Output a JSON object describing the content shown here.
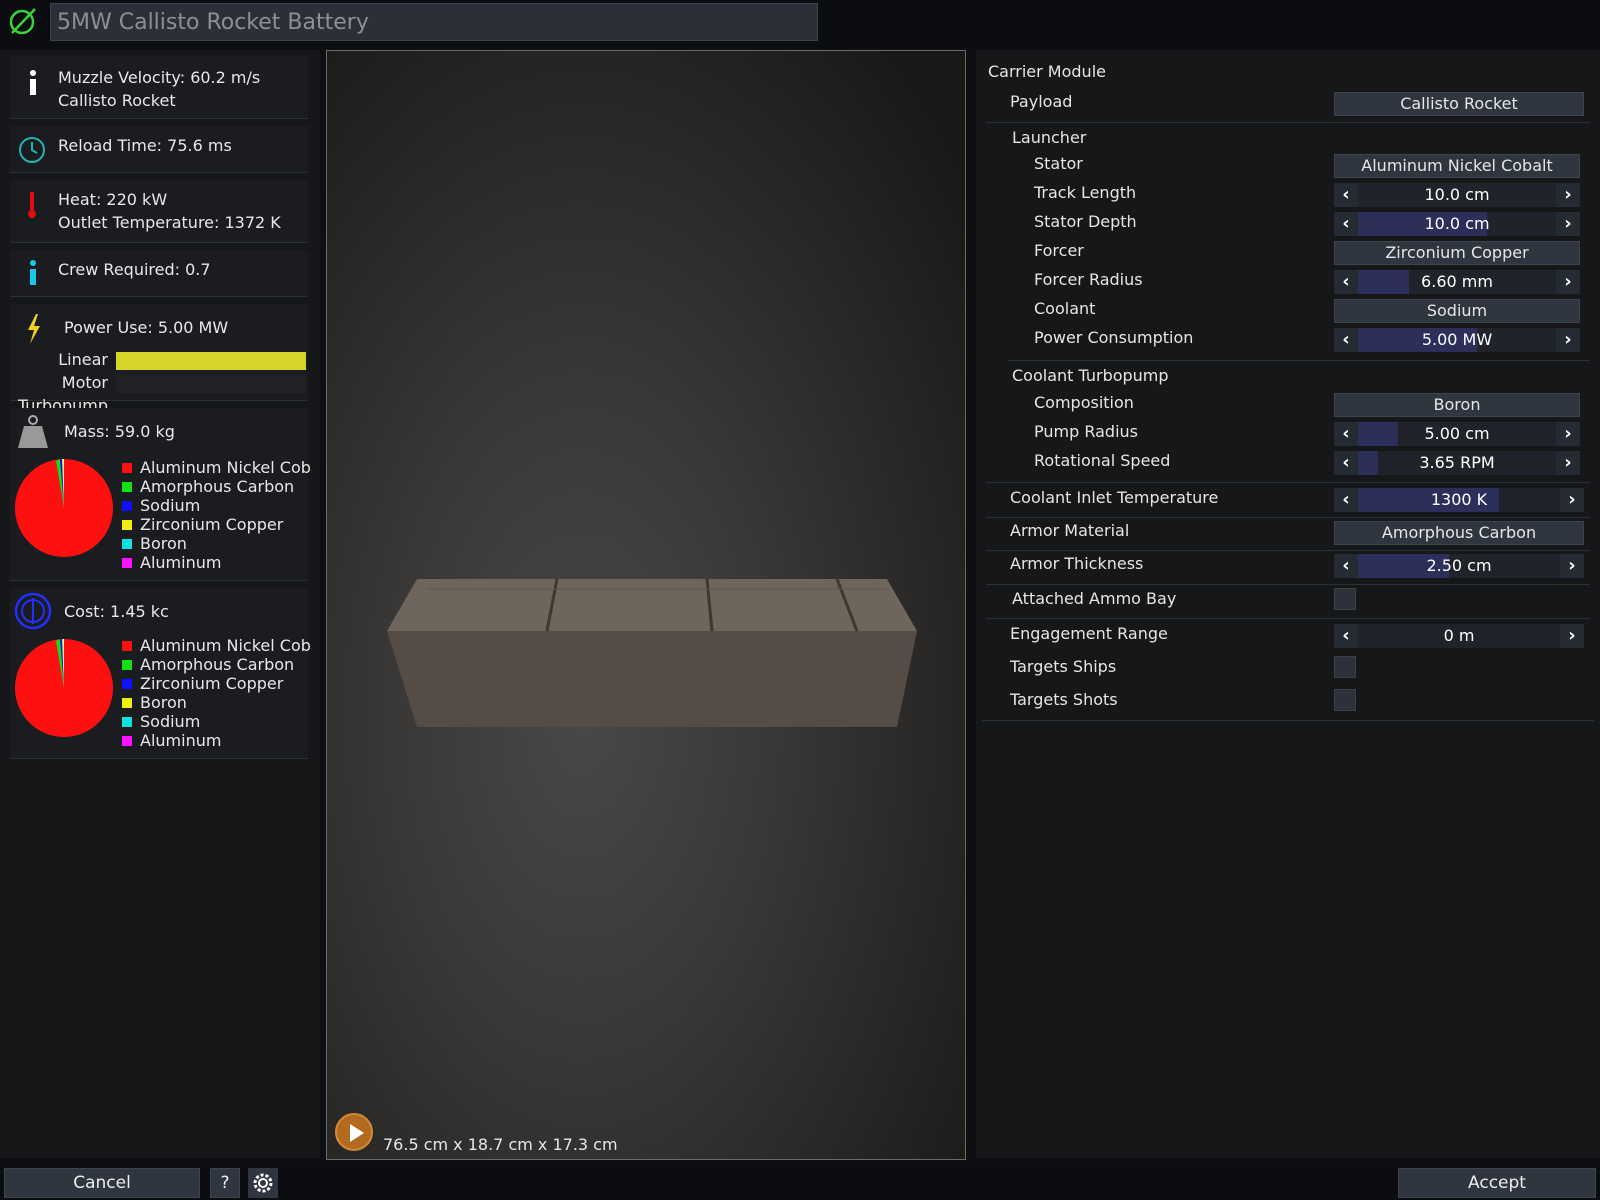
{
  "window": {
    "title": "5MW Callisto Rocket Battery"
  },
  "stats": {
    "muzzle_velocity": "Muzzle Velocity: 60.2 m/s",
    "payload_name": "Callisto Rocket",
    "reload_time": "Reload Time: 75.6 ms",
    "heat": "Heat: 220 kW",
    "outlet_temperature": "Outlet Temperature: 1372 K",
    "crew": "Crew Required: 0.7",
    "power_use": "Power Use: 5.00 MW",
    "power_bars": [
      {
        "label": "Linear Motor",
        "fraction": 1.0,
        "color": "#d6d62a"
      },
      {
        "label": "Turbopump",
        "fraction": 0.0,
        "color": "#d6d62a"
      }
    ],
    "mass": "Mass: 59.0 kg",
    "mass_legend": [
      {
        "label": "Aluminum Nickel Cobalt",
        "color": "#ff1010"
      },
      {
        "label": "Amorphous Carbon",
        "color": "#10e010"
      },
      {
        "label": "Sodium",
        "color": "#1010ff"
      },
      {
        "label": "Zirconium Copper",
        "color": "#f0f010"
      },
      {
        "label": "Boron",
        "color": "#10e0e0"
      },
      {
        "label": "Aluminum",
        "color": "#ff10ff"
      }
    ],
    "cost": "Cost: 1.45 kc",
    "cost_legend": [
      {
        "label": "Aluminum Nickel Cobalt",
        "color": "#ff1010"
      },
      {
        "label": "Amorphous Carbon",
        "color": "#10e010"
      },
      {
        "label": "Zirconium Copper",
        "color": "#1010ff"
      },
      {
        "label": "Boron",
        "color": "#f0f010"
      },
      {
        "label": "Sodium",
        "color": "#10e0e0"
      },
      {
        "label": "Aluminum",
        "color": "#ff10ff"
      }
    ]
  },
  "preview": {
    "dimensions": "76.5 cm x 18.7 cm x 17.3 cm"
  },
  "config": {
    "carrier_module": "Carrier Module",
    "payload": {
      "label": "Payload",
      "value": "Callisto Rocket"
    },
    "launcher": "Launcher",
    "stator": {
      "label": "Stator",
      "value": "Aluminum Nickel Cobalt"
    },
    "track_length": {
      "label": "Track Length",
      "value": "10.0 cm",
      "fraction": 0.0
    },
    "stator_depth": {
      "label": "Stator Depth",
      "value": "10.0 cm",
      "fraction": 0.65
    },
    "forcer": {
      "label": "Forcer",
      "value": "Zirconium Copper"
    },
    "forcer_radius": {
      "label": "Forcer Radius",
      "value": "6.60 mm",
      "fraction": 0.26
    },
    "coolant": {
      "label": "Coolant",
      "value": "Sodium"
    },
    "power_consumption": {
      "label": "Power Consumption",
      "value": "5.00 MW",
      "fraction": 0.6
    },
    "coolant_turbopump": "Coolant Turbopump",
    "composition": {
      "label": "Composition",
      "value": "Boron"
    },
    "pump_radius": {
      "label": "Pump Radius",
      "value": "5.00 cm",
      "fraction": 0.2
    },
    "rotational_speed": {
      "label": "Rotational Speed",
      "value": "3.65 RPM",
      "fraction": 0.1
    },
    "coolant_inlet_temperature": {
      "label": "Coolant Inlet Temperature",
      "value": "1300 K",
      "fraction": 0.7
    },
    "armor_material": {
      "label": "Armor Material",
      "value": "Amorphous Carbon"
    },
    "armor_thickness": {
      "label": "Armor Thickness",
      "value": "2.50 cm",
      "fraction": 0.45
    },
    "attached_ammo_bay": {
      "label": "Attached Ammo Bay",
      "checked": false
    },
    "engagement_range": {
      "label": "Engagement Range",
      "value": "0 m",
      "fraction": 0.0
    },
    "targets_ships": {
      "label": "Targets Ships",
      "checked": false
    },
    "targets_shots": {
      "label": "Targets Shots",
      "checked": false
    }
  },
  "footer": {
    "cancel": "Cancel",
    "help": "?",
    "accept": "Accept"
  }
}
